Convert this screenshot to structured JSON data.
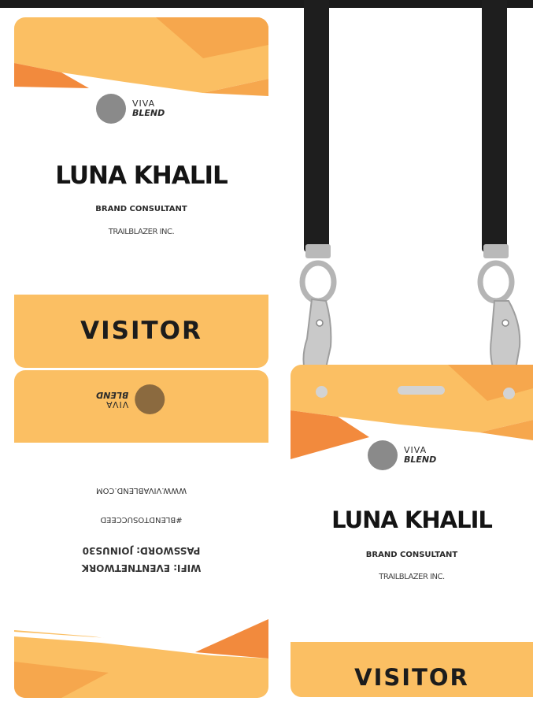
{
  "colors": {
    "orange_light": "#fbbf63",
    "orange_dark": "#f28a3d",
    "orange_mid": "#f6a74d",
    "text": "#141414",
    "strap": "#1e1e1e"
  },
  "brand": {
    "line1": "VIVA",
    "line2": "BLEND",
    "logo_icon": "grey-circle-icon"
  },
  "badge": {
    "name": "LUNA KHALIL",
    "role": "BRAND CONSULTANT",
    "company": "TRAILBLAZER INC.",
    "visitor": "VISITOR"
  },
  "back": {
    "website": "WWW.VIVABLEND.COM",
    "hashtag": "#BLENDTOSUCCEED",
    "wifi": "WIFI: EVENTNETWORK",
    "password": "PASSWORD: JOINUS30"
  }
}
